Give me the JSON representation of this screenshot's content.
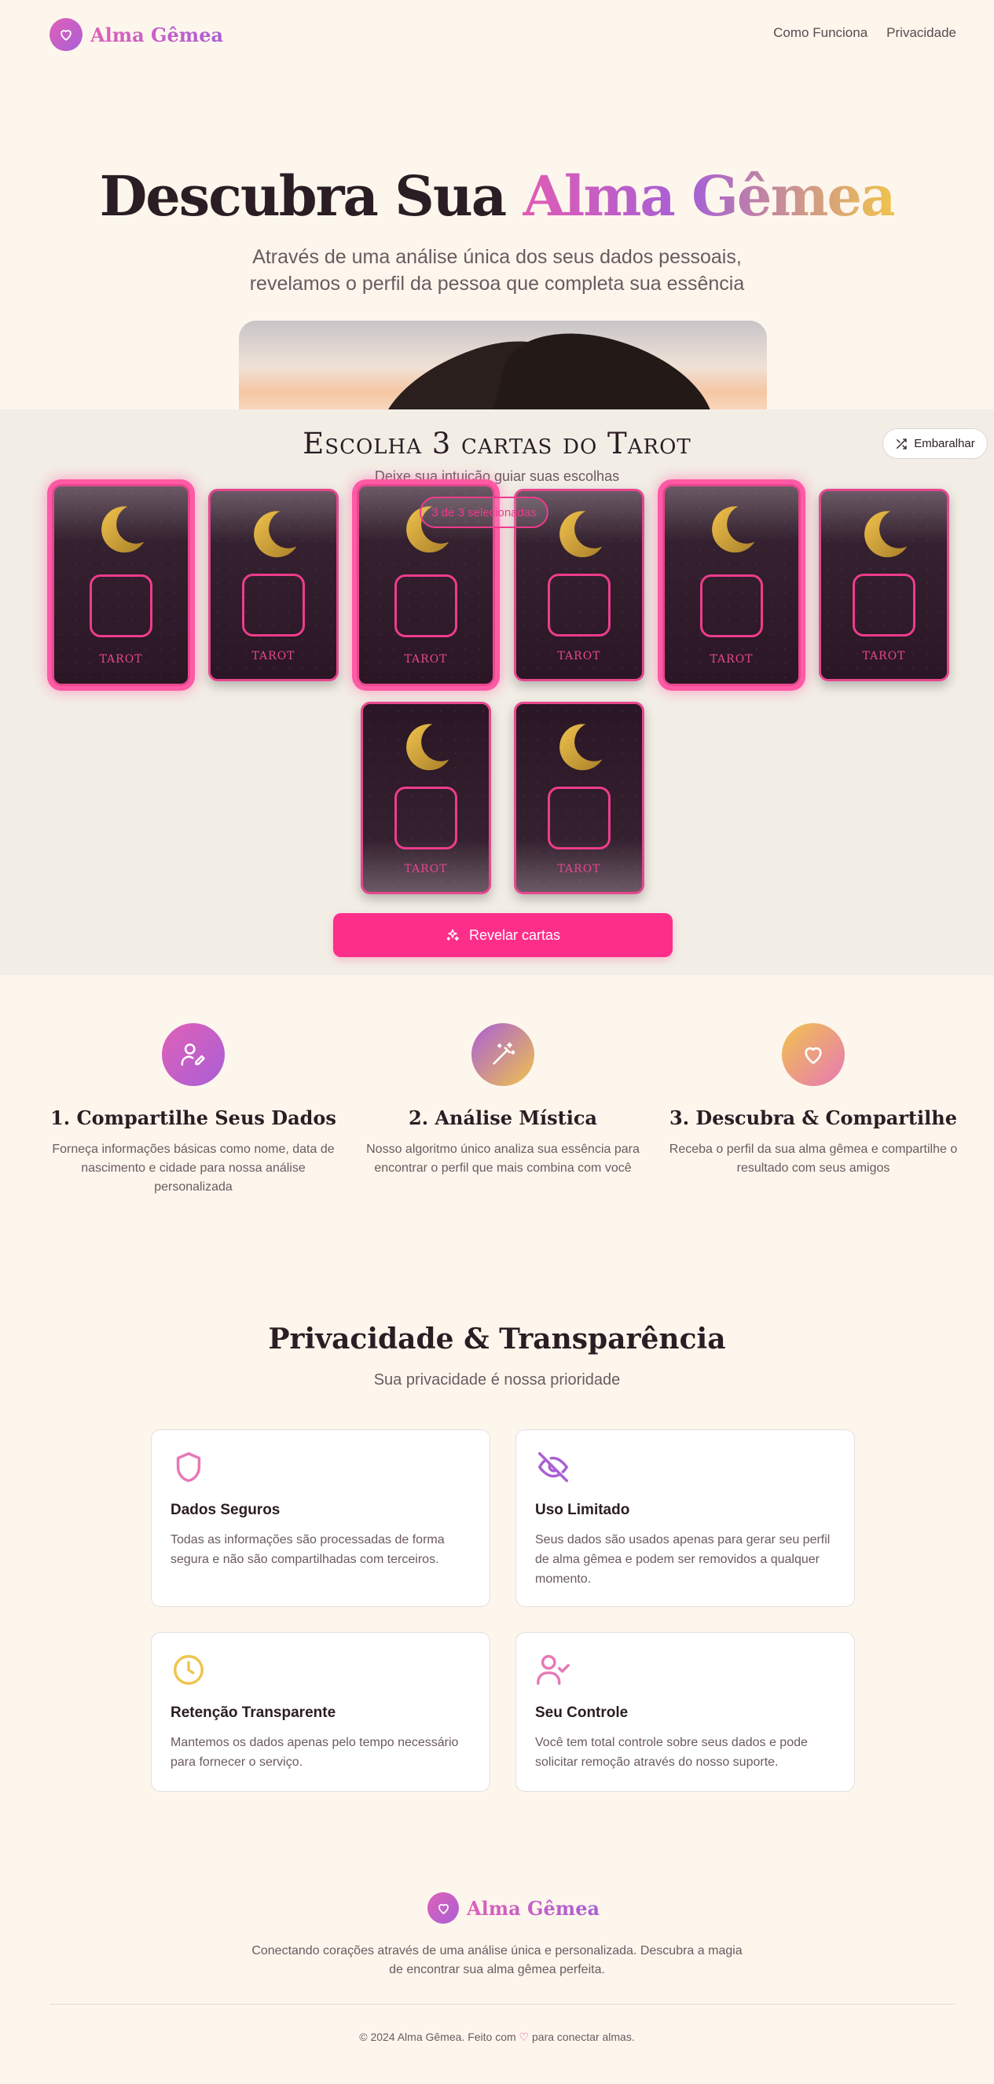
{
  "header": {
    "brand": "Alma Gêmea",
    "nav": [
      "Como Funciona",
      "Privacidade"
    ]
  },
  "hero": {
    "title_plain": "Descubra Sua ",
    "title_highlight": "Alma Gêmea",
    "subtitle_line1": "Através de uma análise única dos seus dados pessoais,",
    "subtitle_line2": "revelamos o perfil da pessoa que completa sua essência"
  },
  "tarot": {
    "title": "Escolha 3 cartas do Tarot",
    "subtitle": "Deixe sua intuição guiar suas escolhas",
    "shuffle_label": "Embaralhar",
    "counter": "3 de 3 selecionadas",
    "card_label": "TAROT",
    "cards_selected": [
      true,
      false,
      true,
      false,
      true,
      false,
      false,
      false
    ],
    "reveal_label": "Revelar cartas"
  },
  "steps": [
    {
      "title": "1. Compartilhe Seus Dados",
      "text": "Forneça informações básicas como nome, data de nascimento e cidade para nossa análise personalizada",
      "icon": "user-pen-icon"
    },
    {
      "title": "2. Análise Mística",
      "text": "Nosso algoritmo único analiza sua essência para encontrar o perfil que mais combina com você",
      "icon": "magic-wand-icon"
    },
    {
      "title": "3. Descubra & Compartilhe",
      "text": "Receba o perfil da sua alma gêmea e compartilhe o resultado com seus amigos",
      "icon": "heart-icon"
    }
  ],
  "privacy": {
    "title": "Privacidade & Transparência",
    "subtitle": "Sua privacidade é nossa prioridade",
    "cards": [
      {
        "title": "Dados Seguros",
        "text": "Todas as informações são processadas de forma segura e não são compartilhadas com terceiros.",
        "icon": "shield-icon"
      },
      {
        "title": "Uso Limitado",
        "text": "Seus dados são usados apenas para gerar seu perfil de alma gêmea e podem ser removidos a qualquer momento.",
        "icon": "eye-off-icon"
      },
      {
        "title": "Retenção Transparente",
        "text": "Mantemos os dados apenas pelo tempo necessário para fornecer o serviço.",
        "icon": "clock-icon"
      },
      {
        "title": "Seu Controle",
        "text": "Você tem total controle sobre seus dados e pode solicitar remoção através do nosso suporte.",
        "icon": "user-check-icon"
      }
    ]
  },
  "footer": {
    "brand": "Alma Gêmea",
    "text_line1": "Conectando corações através de uma análise única e personalizada. Descubra a magia",
    "text_line2": "de encontrar sua alma gêmea perfeita.",
    "copy_before": "© 2024 Alma Gêmea. Feito com",
    "copy_heart": "♡",
    "copy_after": "para conectar almas."
  },
  "colors": {
    "background": "#fdf6ec",
    "accent": "#fd2e8a",
    "purple": "#a95fd6",
    "gold": "#f0c34d"
  }
}
